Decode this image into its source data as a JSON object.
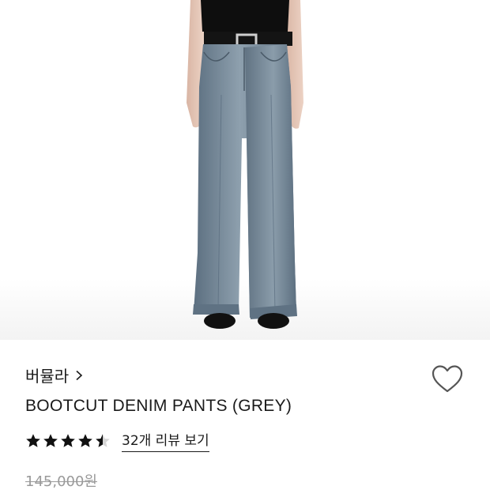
{
  "product": {
    "brand": "버뮬라",
    "title": "BOOTCUT DENIM PANTS (GREY)",
    "rating_value": 4.5,
    "rating_max": 5,
    "review_link_label": "32개 리뷰 보기",
    "original_price": "145,000원"
  },
  "icons": {
    "brand": "chevron-right-icon",
    "wishlist": "heart-outline-icon",
    "rating": "star-icon"
  },
  "colors": {
    "text": "#1a1a1a",
    "muted_price": "#9a9a9a",
    "denim": "#6f8190"
  }
}
